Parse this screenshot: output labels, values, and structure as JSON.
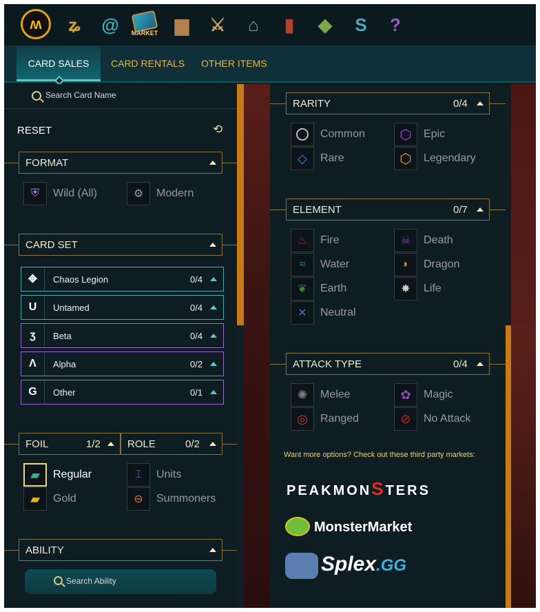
{
  "topbar": {
    "icons": [
      "monster-home-icon",
      "zigzag-icon",
      "swirl-icon",
      "market-icon",
      "scroll-icon",
      "sword-icon",
      "guild-hall-icon",
      "banner-icon",
      "land-icon",
      "splinter-icon",
      "help-icon"
    ],
    "market_label": "MARKET"
  },
  "tabs": [
    "CARD SALES",
    "CARD RENTALS",
    "OTHER ITEMS"
  ],
  "search": {
    "placeholder": "Search Card Name"
  },
  "reset": "RESET",
  "format": {
    "title": "FORMAT",
    "options": [
      "Wild (All)",
      "Modern"
    ]
  },
  "card_set": {
    "title": "CARD SET",
    "items": [
      {
        "name": "Chaos Legion",
        "count": "0/4"
      },
      {
        "name": "Untamed",
        "count": "0/4"
      },
      {
        "name": "Beta",
        "count": "0/4"
      },
      {
        "name": "Alpha",
        "count": "0/2"
      },
      {
        "name": "Other",
        "count": "0/1"
      }
    ]
  },
  "foil": {
    "title": "FOIL",
    "count": "1/2",
    "options": [
      "Regular",
      "Gold"
    ]
  },
  "role": {
    "title": "ROLE",
    "count": "0/2",
    "options": [
      "Units",
      "Summoners"
    ]
  },
  "ability": {
    "title": "ABILITY",
    "search_placeholder": "Search Ability"
  },
  "rarity": {
    "title": "RARITY",
    "count": "0/4",
    "options": [
      "Common",
      "Epic",
      "Rare",
      "Legendary"
    ]
  },
  "element": {
    "title": "ELEMENT",
    "count": "0/7",
    "options": [
      "Fire",
      "Death",
      "Water",
      "Dragon",
      "Earth",
      "Life",
      "Neutral"
    ]
  },
  "attack_type": {
    "title": "ATTACK TYPE",
    "count": "0/4",
    "options": [
      "Melee",
      "Magic",
      "Ranged",
      "No Attack"
    ]
  },
  "third_party": {
    "title": "Want more options? Check out these third party markets:",
    "peakmonsters_a": "PEAKMON",
    "peakmonsters_s": "S",
    "peakmonsters_b": "TERS",
    "monstermarket": "MonsterMarket",
    "splex": "Splex",
    "splex_gg": ".GG"
  },
  "colors": {
    "accent_gold": "#c67a18",
    "teal": "#5fc8c4",
    "panel": "#0d1d22"
  }
}
